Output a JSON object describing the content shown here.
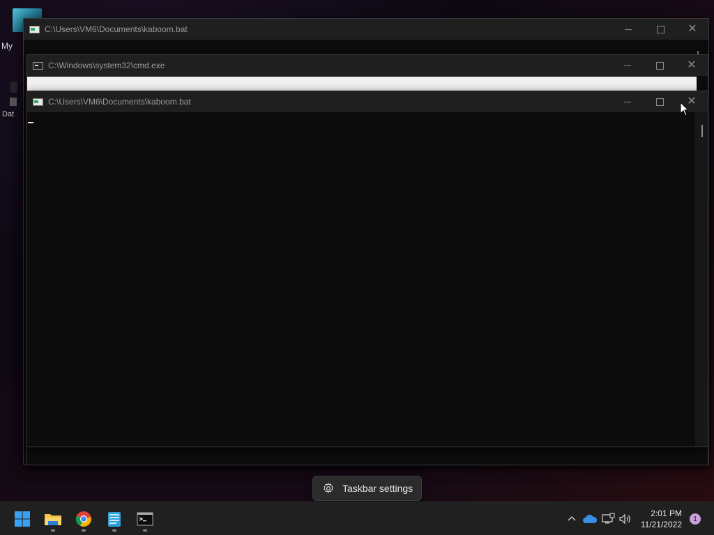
{
  "desktop": {
    "icon1_label": "My",
    "icon2_label": "Dat"
  },
  "windows": [
    {
      "title": "C:\\Users\\VM6\\Documents\\kaboom.bat",
      "icon": "batch-file-icon"
    },
    {
      "title": "C:\\Windows\\system32\\cmd.exe",
      "icon": "cmd-icon"
    },
    {
      "title": "C:\\Users\\VM6\\Documents\\kaboom.bat",
      "icon": "batch-file-icon"
    }
  ],
  "popup": {
    "label": "Taskbar settings",
    "icon": "gear-icon"
  },
  "taskbar": {
    "apps": [
      "start-button",
      "file-explorer",
      "chrome",
      "notepad",
      "terminal"
    ],
    "clock_time": "2:01 PM",
    "clock_date": "11/21/2022",
    "notification_count": "1"
  },
  "colors": {
    "taskbar_bg": "#202020",
    "window_bg": "#0c0c0c",
    "titlebar_bg": "#1f1f1f"
  }
}
